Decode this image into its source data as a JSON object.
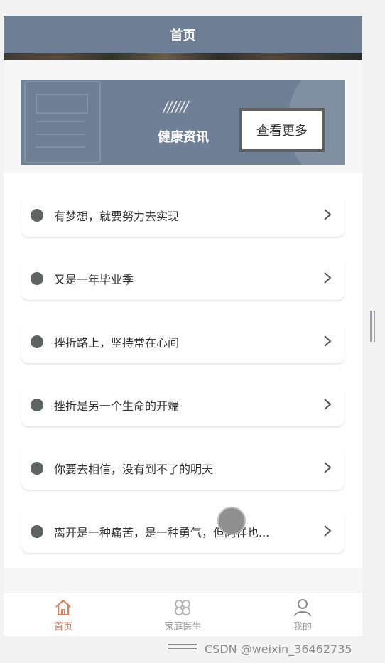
{
  "nav": {
    "title": "首页"
  },
  "news": {
    "slashes": "//////",
    "title": "健康资讯",
    "more_label": "查看更多"
  },
  "list": [
    {
      "text": "有梦想，就要努力去实现"
    },
    {
      "text": "又是一年毕业季"
    },
    {
      "text": "挫折路上，坚持常在心间"
    },
    {
      "text": "挫折是另一个生命的开端"
    },
    {
      "text": "你要去相信，没有到不了的明天"
    },
    {
      "text": "离开是一种痛苦，是一种勇气，但同样也..."
    }
  ],
  "tabs": [
    {
      "label": "首页",
      "icon": "home-icon",
      "active": true
    },
    {
      "label": "家庭医生",
      "icon": "clover-icon",
      "active": false
    },
    {
      "label": "我的",
      "icon": "user-icon",
      "active": false
    }
  ],
  "watermark": "CSDN @weixin_36462735",
  "colors": {
    "header_bg": "#6e7f95",
    "active_tab": "#e27a5a",
    "inactive_tab": "#9a9a9a",
    "dot": "#5d6461"
  }
}
